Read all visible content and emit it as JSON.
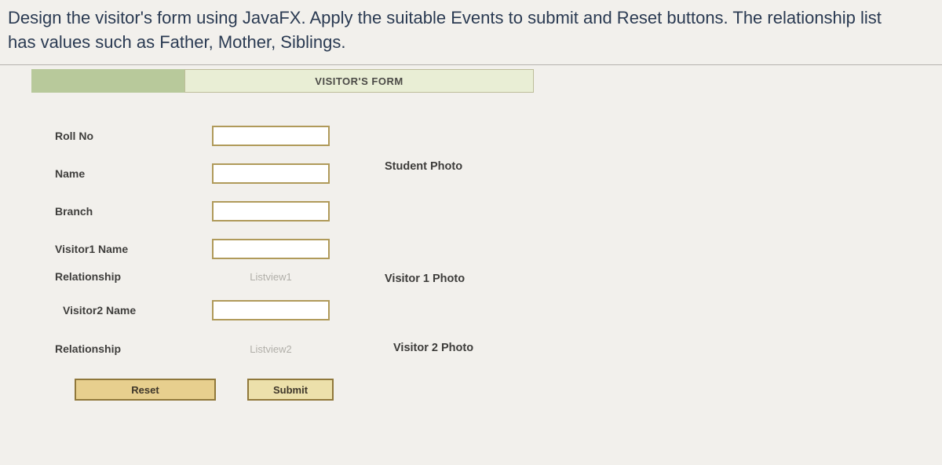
{
  "question": {
    "line1": "Design the visitor's form using JavaFX. Apply the suitable Events to submit and Reset buttons. The relationship list",
    "line2": "has values such as Father, Mother, Siblings."
  },
  "form": {
    "title": "VISITOR'S FORM",
    "labels": {
      "rollno": "Roll No",
      "name": "Name",
      "branch": "Branch",
      "visitor1name": "Visitor1 Name",
      "relationship1": "Relationship",
      "visitor2name": "Visitor2 Name",
      "relationship2": "Relationship"
    },
    "listview1": "Listview1",
    "listview2": "Listview2",
    "buttons": {
      "reset": "Reset",
      "submit": "Submit"
    },
    "photos": {
      "student": "Student Photo",
      "visitor1": "Visitor 1 Photo",
      "visitor2": "Visitor 2 Photo"
    }
  }
}
